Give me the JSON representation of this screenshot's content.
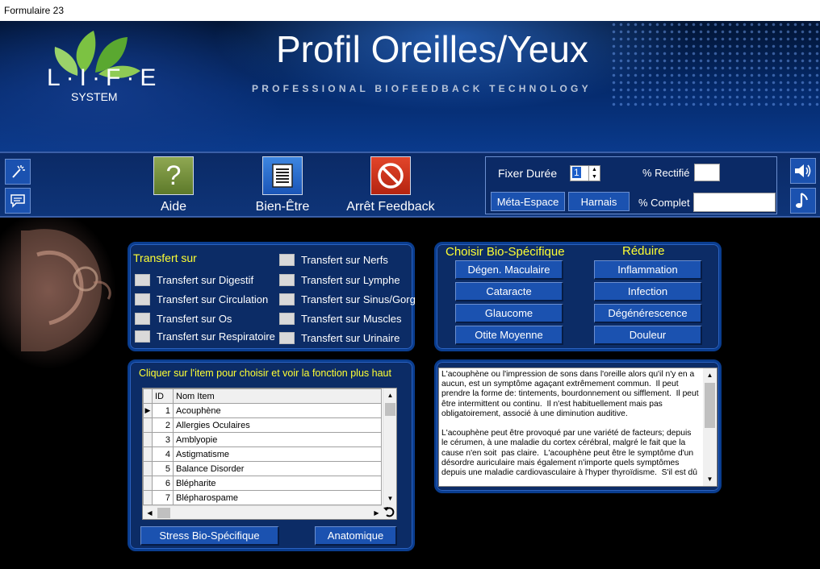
{
  "window": {
    "title": "Formulaire 23"
  },
  "header": {
    "logo_text": "L·I·F·E",
    "logo_sub": "SYSTEM",
    "title": "Profil Oreilles/Yeux",
    "tagline": "PROFESSIONAL BIOFEEDBACK TECHNOLOGY"
  },
  "toolbar": {
    "help_label": "Aide",
    "wellbeing_label": "Bien-Être",
    "stop_label": "Arrêt Feedback"
  },
  "timer": {
    "duration_label": "Fixer Durée",
    "duration_value": "1",
    "rectified_label": "% Rectifié",
    "complete_label": "% Complet",
    "meta_space_button": "Méta-Espace",
    "harness_button": "Harnais"
  },
  "transfer": {
    "heading": "Transfert sur",
    "left": [
      "Transfert sur Digestif",
      "Transfert sur Circulation",
      "Transfert sur Os",
      "Transfert sur Respiratoire"
    ],
    "right": [
      "Transfert sur Nerfs",
      "Transfert sur Lymphe",
      "Transfert sur Sinus/Gorg",
      "Transfert sur Muscles",
      "Transfert sur Urinaire"
    ]
  },
  "biospecific": {
    "heading": "Choisir Bio-Spécifique",
    "items": [
      "Dégen. Maculaire",
      "Cataracte",
      "Glaucome",
      "Otite Moyenne"
    ]
  },
  "reduce": {
    "heading": "Réduire",
    "items": [
      "Inflammation",
      "Infection",
      "Dégénérescence",
      "Douleur"
    ]
  },
  "list": {
    "instruction": "Cliquer sur l'item pour choisir et voir la fonction plus haut",
    "col_id": "ID",
    "col_name": "Nom Item",
    "rows": [
      {
        "id": "1",
        "name": "Acouphène"
      },
      {
        "id": "2",
        "name": "Allergies Oculaires"
      },
      {
        "id": "3",
        "name": "Amblyopie"
      },
      {
        "id": "4",
        "name": "Astigmatisme"
      },
      {
        "id": "5",
        "name": "Balance Disorder"
      },
      {
        "id": "6",
        "name": "Blépharite"
      },
      {
        "id": "7",
        "name": "Blépharospame"
      }
    ],
    "stress_button": "Stress Bio-Spécifique",
    "anatomy_button": "Anatomique"
  },
  "description": {
    "text": "L'acouphène ou l'impression de sons dans l'oreille alors qu'il n'y en a\naucun, est un symptôme agaçant extrêmement commun.  Il peut\nprendre la forme de: tintements, bourdonnement ou sifflement.  Il peut\nêtre intermittent ou continu.  Il n'est habituellement mais pas\nobligatoirement, associé à une diminution auditive.\n\nL'acouphène peut être provoqué par une variété de facteurs; depuis\nle cérumen, à une maladie du cortex cérébral, malgré le fait que la\ncause n'en soit  pas claire.  L'acouphène peut être le symptôme d'un\ndésordre auriculaire mais également n'importe quels symptômes\ndepuis une maladie cardiovasculaire à l'hyper thyroïdisme.  S'il est dû"
  }
}
